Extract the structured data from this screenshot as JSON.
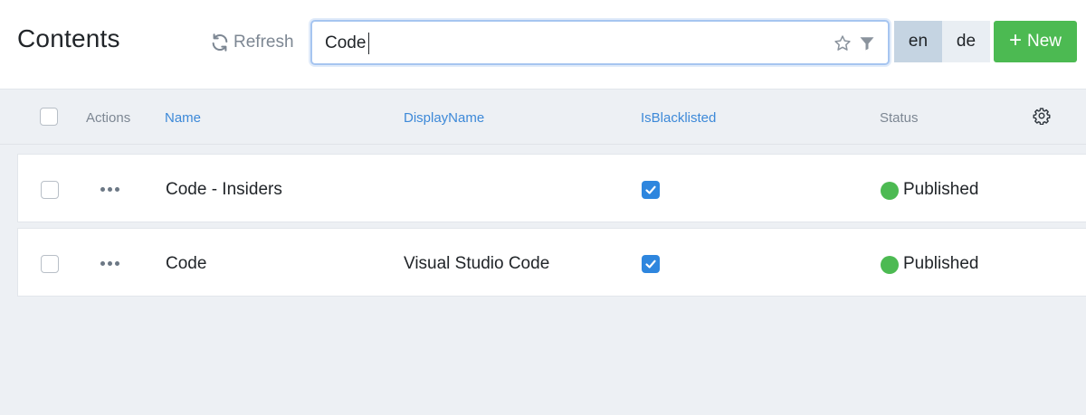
{
  "header": {
    "title": "Contents",
    "refresh_label": "Refresh",
    "search": {
      "value": "Code",
      "placeholder": ""
    },
    "languages": [
      "en",
      "de"
    ],
    "active_language": "en",
    "new_label": "New"
  },
  "table": {
    "columns": {
      "actions": "Actions",
      "name": "Name",
      "display_name": "DisplayName",
      "is_blacklisted": "IsBlacklisted",
      "status": "Status"
    },
    "rows": [
      {
        "name": "Code - Insiders",
        "display_name": "",
        "is_blacklisted": true,
        "status": "Published"
      },
      {
        "name": "Code",
        "display_name": "Visual Studio Code",
        "is_blacklisted": true,
        "status": "Published"
      }
    ]
  },
  "colors": {
    "accent": "#3d89d8",
    "new_button": "#4cba52",
    "status_published": "#4cba52",
    "checkbox_checked": "#2e86de",
    "active_language_bg": "#c5d4e2"
  },
  "icons": {
    "refresh": "refresh-icon",
    "favorite": "star-icon",
    "filter": "filter-icon",
    "add": "plus-icon",
    "settings": "gear-icon",
    "row_actions": "more-horizontal-icon"
  }
}
